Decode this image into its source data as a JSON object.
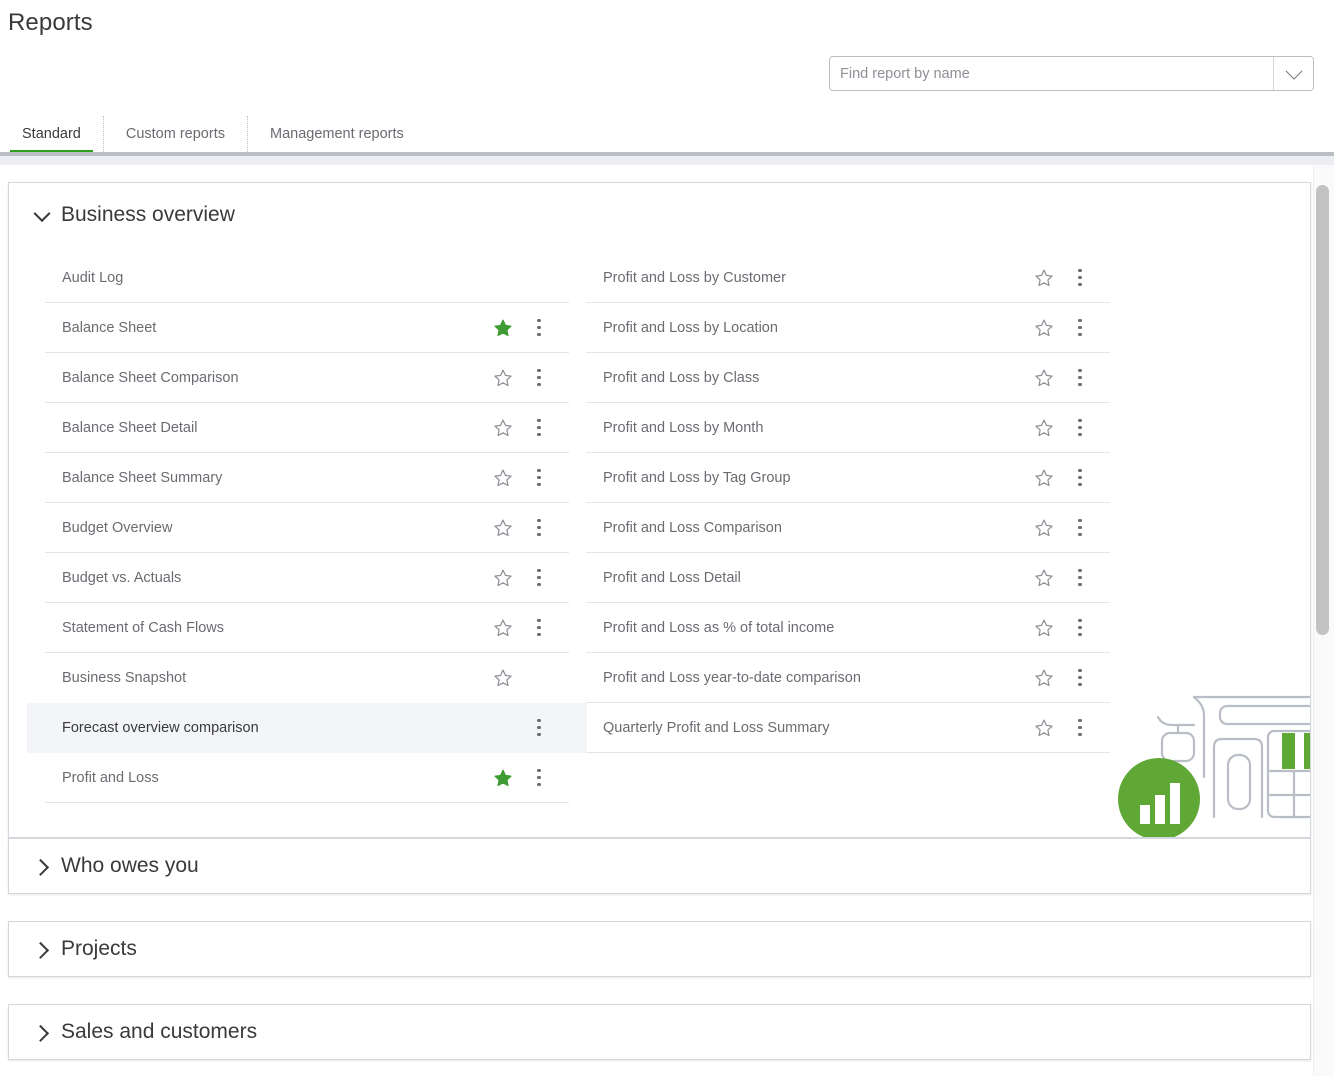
{
  "page": {
    "title": "Reports"
  },
  "search": {
    "placeholder": "Find report by name",
    "value": "",
    "toggle_icon": "chevron-down-icon"
  },
  "tabs": [
    {
      "label": "Standard",
      "active": true
    },
    {
      "label": "Custom reports",
      "active": false
    },
    {
      "label": "Management reports",
      "active": false
    }
  ],
  "colors": {
    "accent_green": "#2ca01c",
    "star_filled": "#3f9c35",
    "star_outline": "#8d9096",
    "text_primary": "#393a3d",
    "text_secondary": "#6b6c72",
    "row_hover_bg": "#f4f5f8",
    "border": "#d4d7dc"
  },
  "sections": [
    {
      "id": "business-overview",
      "label": "Business overview",
      "expanded": true,
      "chevron_icon": "chevron-down-icon",
      "columns": [
        {
          "items": [
            {
              "label": "Audit Log",
              "favorite": false,
              "show_star": false,
              "show_menu": false,
              "hovered": false,
              "separator": true
            },
            {
              "label": "Balance Sheet",
              "favorite": true,
              "show_star": true,
              "show_menu": true,
              "hovered": false,
              "separator": true
            },
            {
              "label": "Balance Sheet Comparison",
              "favorite": false,
              "show_star": true,
              "show_menu": true,
              "hovered": false,
              "separator": true
            },
            {
              "label": "Balance Sheet Detail",
              "favorite": false,
              "show_star": true,
              "show_menu": true,
              "hovered": false,
              "separator": true
            },
            {
              "label": "Balance Sheet Summary",
              "favorite": false,
              "show_star": true,
              "show_menu": true,
              "hovered": false,
              "separator": true
            },
            {
              "label": "Budget Overview",
              "favorite": false,
              "show_star": true,
              "show_menu": true,
              "hovered": false,
              "separator": true
            },
            {
              "label": "Budget vs. Actuals",
              "favorite": false,
              "show_star": true,
              "show_menu": true,
              "hovered": false,
              "separator": true
            },
            {
              "label": "Statement of Cash Flows",
              "favorite": false,
              "show_star": true,
              "show_menu": true,
              "hovered": false,
              "separator": true
            },
            {
              "label": "Business Snapshot",
              "favorite": false,
              "show_star": true,
              "show_menu": false,
              "hovered": false,
              "separator": false
            },
            {
              "label": "Forecast overview comparison",
              "favorite": false,
              "show_star": false,
              "show_menu": true,
              "hovered": true,
              "separator": false
            },
            {
              "label": "Profit and Loss",
              "favorite": true,
              "show_star": true,
              "show_menu": true,
              "hovered": false,
              "separator": true
            }
          ]
        },
        {
          "items": [
            {
              "label": "Profit and Loss by Customer",
              "favorite": false,
              "show_star": true,
              "show_menu": true,
              "hovered": false,
              "separator": true
            },
            {
              "label": "Profit and Loss by Location",
              "favorite": false,
              "show_star": true,
              "show_menu": true,
              "hovered": false,
              "separator": true
            },
            {
              "label": "Profit and Loss by Class",
              "favorite": false,
              "show_star": true,
              "show_menu": true,
              "hovered": false,
              "separator": true
            },
            {
              "label": "Profit and Loss by Month",
              "favorite": false,
              "show_star": true,
              "show_menu": true,
              "hovered": false,
              "separator": true
            },
            {
              "label": "Profit and Loss by Tag Group",
              "favorite": false,
              "show_star": true,
              "show_menu": true,
              "hovered": false,
              "separator": true
            },
            {
              "label": "Profit and Loss Comparison",
              "favorite": false,
              "show_star": true,
              "show_menu": true,
              "hovered": false,
              "separator": true
            },
            {
              "label": "Profit and Loss Detail",
              "favorite": false,
              "show_star": true,
              "show_menu": true,
              "hovered": false,
              "separator": true
            },
            {
              "label": "Profit and Loss as % of total income",
              "favorite": false,
              "show_star": true,
              "show_menu": true,
              "hovered": false,
              "separator": true
            },
            {
              "label": "Profit and Loss year-to-date comparison",
              "favorite": false,
              "show_star": true,
              "show_menu": true,
              "hovered": false,
              "separator": true
            },
            {
              "label": "Quarterly Profit and Loss Summary",
              "favorite": false,
              "show_star": true,
              "show_menu": true,
              "hovered": false,
              "separator": true
            }
          ]
        }
      ]
    },
    {
      "id": "who-owes-you",
      "label": "Who owes you",
      "expanded": false,
      "chevron_icon": "chevron-right-icon",
      "columns": []
    },
    {
      "id": "projects",
      "label": "Projects",
      "expanded": false,
      "chevron_icon": "chevron-right-icon",
      "columns": []
    },
    {
      "id": "sales-customers",
      "label": "Sales and customers",
      "expanded": false,
      "chevron_icon": "chevron-right-icon",
      "columns": []
    }
  ],
  "illustration": {
    "name": "storefront-bar-chart-illustration",
    "badge_icon": "bar-chart-icon"
  },
  "scrollbar": {
    "name": "vertical-scrollbar"
  }
}
